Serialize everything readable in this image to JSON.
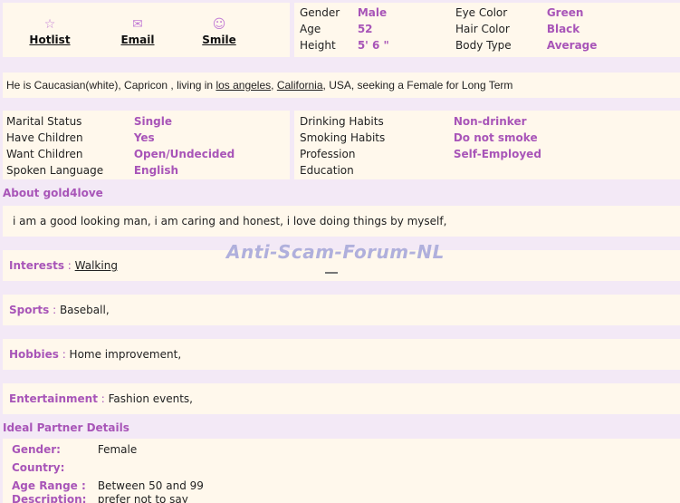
{
  "actions": [
    {
      "icon": "☆",
      "label": "Hotlist"
    },
    {
      "icon": "✉",
      "label": "Email"
    },
    {
      "icon": "☺",
      "label": "Smile"
    }
  ],
  "basics_left": [
    {
      "label": "Gender",
      "value": "Male"
    },
    {
      "label": "Age",
      "value": "52"
    },
    {
      "label": "Height",
      "value": "5' 6 \""
    }
  ],
  "basics_right": [
    {
      "label": "Eye Color",
      "value": "Green"
    },
    {
      "label": "Hair Color",
      "value": "Black"
    },
    {
      "label": "Body Type",
      "value": "Average"
    }
  ],
  "summary": {
    "prefix": "He is Caucasian(white), Capricon , living in ",
    "city": "los angeles",
    "sep": ", ",
    "state": "California",
    "suffix": ", USA, seeking a Female for Long Term"
  },
  "details_left": [
    {
      "label": "Marital Status",
      "value": "Single"
    },
    {
      "label": "Have Children",
      "value": "Yes"
    },
    {
      "label": "Want Children",
      "value": "Open/Undecided"
    },
    {
      "label": "Spoken Language",
      "value": "English"
    }
  ],
  "details_right": [
    {
      "label": "Drinking Habits",
      "value": "Non-drinker"
    },
    {
      "label": "Smoking Habits",
      "value": "Do not smoke"
    },
    {
      "label": "Profession",
      "value": "Self-Employed"
    },
    {
      "label": "Education",
      "value": ""
    }
  ],
  "about": {
    "heading": "About gold4love",
    "text": "i am a good looking man, i am caring and honest, i love doing things by myself,"
  },
  "interests": {
    "label": "Interests",
    "sep": " : ",
    "value": "Walking"
  },
  "sports": {
    "label": "Sports",
    "sep": " : ",
    "value": "Baseball,"
  },
  "hobbies": {
    "label": "Hobbies",
    "sep": " : ",
    "value": "Home improvement,"
  },
  "entertainment": {
    "label": "Entertainment",
    "sep": " : ",
    "value": "Fashion events,"
  },
  "partner": {
    "heading": "Ideal Partner Details",
    "rows": [
      {
        "label": "Gender:",
        "value": "Female"
      },
      {
        "label": "Country:",
        "value": ""
      },
      {
        "label": "Age Range :",
        "value": "Between 50 and 99"
      },
      {
        "label": "Description:",
        "value": "prefer not to say"
      }
    ]
  },
  "watermark": "Anti-Scam-Forum-NL"
}
